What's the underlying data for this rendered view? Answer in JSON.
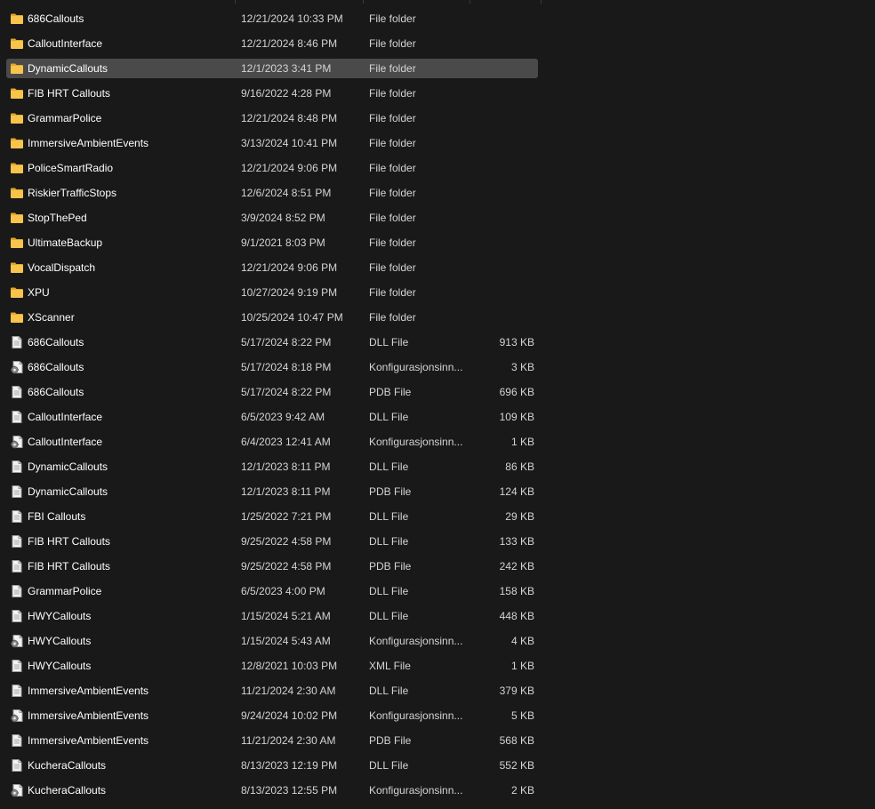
{
  "rows": [
    {
      "name": "686Callouts",
      "date": "12/21/2024 10:33 PM",
      "type": "File folder",
      "size": "",
      "icon": "folder-icon",
      "selected": false
    },
    {
      "name": "CalloutInterface",
      "date": "12/21/2024 8:46 PM",
      "type": "File folder",
      "size": "",
      "icon": "folder-icon",
      "selected": false
    },
    {
      "name": "DynamicCallouts",
      "date": "12/1/2023 3:41 PM",
      "type": "File folder",
      "size": "",
      "icon": "folder-icon",
      "selected": true
    },
    {
      "name": "FIB HRT Callouts",
      "date": "9/16/2022 4:28 PM",
      "type": "File folder",
      "size": "",
      "icon": "folder-icon",
      "selected": false
    },
    {
      "name": "GrammarPolice",
      "date": "12/21/2024 8:48 PM",
      "type": "File folder",
      "size": "",
      "icon": "folder-icon",
      "selected": false
    },
    {
      "name": "ImmersiveAmbientEvents",
      "date": "3/13/2024 10:41 PM",
      "type": "File folder",
      "size": "",
      "icon": "folder-icon",
      "selected": false
    },
    {
      "name": "PoliceSmartRadio",
      "date": "12/21/2024 9:06 PM",
      "type": "File folder",
      "size": "",
      "icon": "folder-icon",
      "selected": false
    },
    {
      "name": "RiskierTrafficStops",
      "date": "12/6/2024 8:51 PM",
      "type": "File folder",
      "size": "",
      "icon": "folder-icon",
      "selected": false
    },
    {
      "name": "StopThePed",
      "date": "3/9/2024 8:52 PM",
      "type": "File folder",
      "size": "",
      "icon": "folder-icon",
      "selected": false
    },
    {
      "name": "UltimateBackup",
      "date": "9/1/2021 8:03 PM",
      "type": "File folder",
      "size": "",
      "icon": "folder-icon",
      "selected": false
    },
    {
      "name": "VocalDispatch",
      "date": "12/21/2024 9:06 PM",
      "type": "File folder",
      "size": "",
      "icon": "folder-icon",
      "selected": false
    },
    {
      "name": "XPU",
      "date": "10/27/2024 9:19 PM",
      "type": "File folder",
      "size": "",
      "icon": "folder-icon",
      "selected": false
    },
    {
      "name": "XScanner",
      "date": "10/25/2024 10:47 PM",
      "type": "File folder",
      "size": "",
      "icon": "folder-icon",
      "selected": false
    },
    {
      "name": "686Callouts",
      "date": "5/17/2024 8:22 PM",
      "type": "DLL File",
      "size": "913 KB",
      "icon": "file-icon",
      "selected": false
    },
    {
      "name": "686Callouts",
      "date": "5/17/2024 8:18 PM",
      "type": "Konfigurasjonsinn...",
      "size": "3 KB",
      "icon": "config-file-icon",
      "selected": false
    },
    {
      "name": "686Callouts",
      "date": "5/17/2024 8:22 PM",
      "type": "PDB File",
      "size": "696 KB",
      "icon": "file-icon",
      "selected": false
    },
    {
      "name": "CalloutInterface",
      "date": "6/5/2023 9:42 AM",
      "type": "DLL File",
      "size": "109 KB",
      "icon": "file-icon",
      "selected": false
    },
    {
      "name": "CalloutInterface",
      "date": "6/4/2023 12:41 AM",
      "type": "Konfigurasjonsinn...",
      "size": "1 KB",
      "icon": "config-file-icon",
      "selected": false
    },
    {
      "name": "DynamicCallouts",
      "date": "12/1/2023 8:11 PM",
      "type": "DLL File",
      "size": "86 KB",
      "icon": "file-icon",
      "selected": false
    },
    {
      "name": "DynamicCallouts",
      "date": "12/1/2023 8:11 PM",
      "type": "PDB File",
      "size": "124 KB",
      "icon": "file-icon",
      "selected": false
    },
    {
      "name": "FBI Callouts",
      "date": "1/25/2022 7:21 PM",
      "type": "DLL File",
      "size": "29 KB",
      "icon": "file-icon",
      "selected": false
    },
    {
      "name": "FIB HRT Callouts",
      "date": "9/25/2022 4:58 PM",
      "type": "DLL File",
      "size": "133 KB",
      "icon": "file-icon",
      "selected": false
    },
    {
      "name": "FIB HRT Callouts",
      "date": "9/25/2022 4:58 PM",
      "type": "PDB File",
      "size": "242 KB",
      "icon": "file-icon",
      "selected": false
    },
    {
      "name": "GrammarPolice",
      "date": "6/5/2023 4:00 PM",
      "type": "DLL File",
      "size": "158 KB",
      "icon": "file-icon",
      "selected": false
    },
    {
      "name": "HWYCallouts",
      "date": "1/15/2024 5:21 AM",
      "type": "DLL File",
      "size": "448 KB",
      "icon": "file-icon",
      "selected": false
    },
    {
      "name": "HWYCallouts",
      "date": "1/15/2024 5:43 AM",
      "type": "Konfigurasjonsinn...",
      "size": "4 KB",
      "icon": "config-file-icon",
      "selected": false
    },
    {
      "name": "HWYCallouts",
      "date": "12/8/2021 10:03 PM",
      "type": "XML File",
      "size": "1 KB",
      "icon": "file-icon",
      "selected": false
    },
    {
      "name": "ImmersiveAmbientEvents",
      "date": "11/21/2024 2:30 AM",
      "type": "DLL File",
      "size": "379 KB",
      "icon": "file-icon",
      "selected": false
    },
    {
      "name": "ImmersiveAmbientEvents",
      "date": "9/24/2024 10:02 PM",
      "type": "Konfigurasjonsinn...",
      "size": "5 KB",
      "icon": "config-file-icon",
      "selected": false
    },
    {
      "name": "ImmersiveAmbientEvents",
      "date": "11/21/2024 2:30 AM",
      "type": "PDB File",
      "size": "568 KB",
      "icon": "file-icon",
      "selected": false
    },
    {
      "name": "KucheraCallouts",
      "date": "8/13/2023 12:19 PM",
      "type": "DLL File",
      "size": "552 KB",
      "icon": "file-icon",
      "selected": false
    },
    {
      "name": "KucheraCallouts",
      "date": "8/13/2023 12:55 PM",
      "type": "Konfigurasjonsinn...",
      "size": "2 KB",
      "icon": "config-file-icon",
      "selected": false
    }
  ],
  "colors": {
    "background": "#191919",
    "selection": "#4a4a4a",
    "folder_body": "#f8c44c",
    "folder_back": "#e2a828",
    "text": "#ffffff",
    "secondary_text": "#d4d4d4"
  }
}
